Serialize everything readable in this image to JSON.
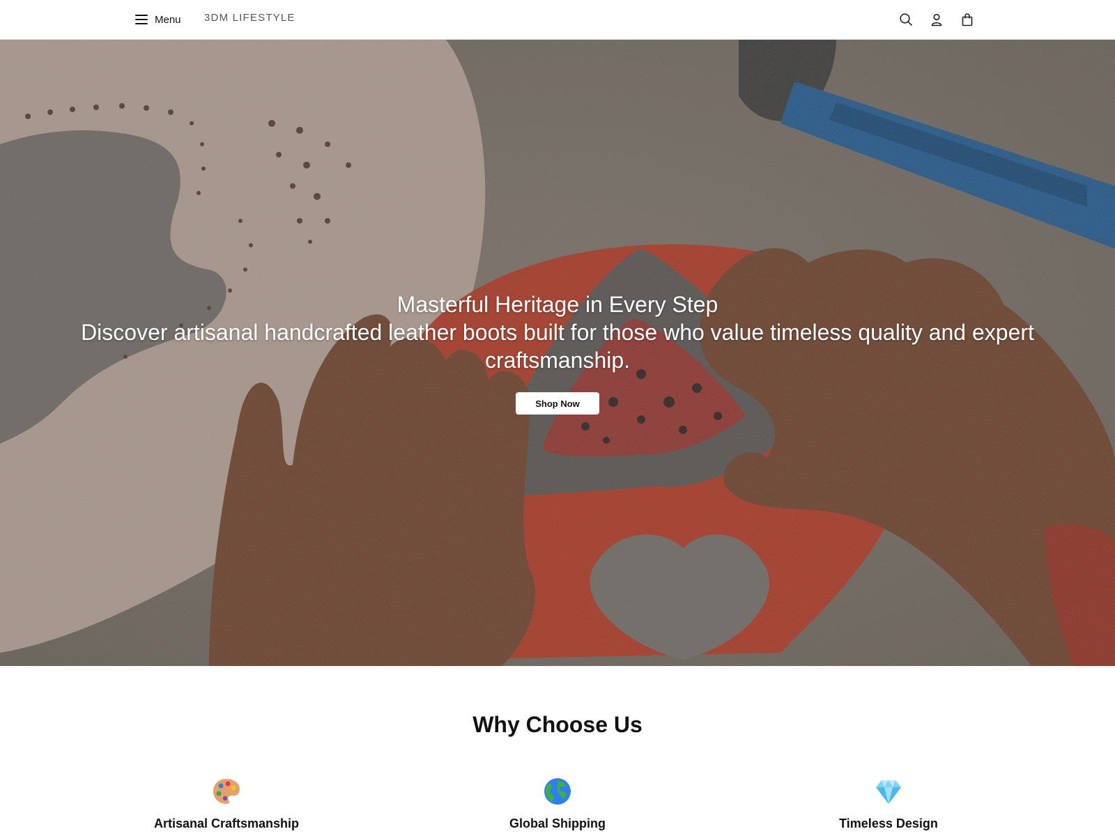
{
  "header": {
    "menu_label": "Menu",
    "brand": "3DM LIFESTYLE",
    "icons": [
      "search-icon",
      "user-icon",
      "bag-icon"
    ]
  },
  "hero": {
    "title": "Masterful Heritage in Every Step",
    "subtitle": "Discover artisanal handcrafted leather boots built for those who value timeless quality and expert craftsmanship.",
    "cta_label": "Shop Now",
    "image_description_colors": {
      "leather_pale": "#d9bfb0",
      "leather_red": "#d9472f",
      "concrete": "#8e8780",
      "hammer_blue": "#2a6fb0",
      "skin": "#8a5236"
    }
  },
  "why": {
    "title": "Why Choose Us",
    "features": [
      {
        "label": "Artisanal Craftsmanship",
        "icon": "palette-icon"
      },
      {
        "label": "Global Shipping",
        "icon": "globe-icon"
      },
      {
        "label": "Timeless Design",
        "icon": "gem-icon"
      }
    ]
  }
}
